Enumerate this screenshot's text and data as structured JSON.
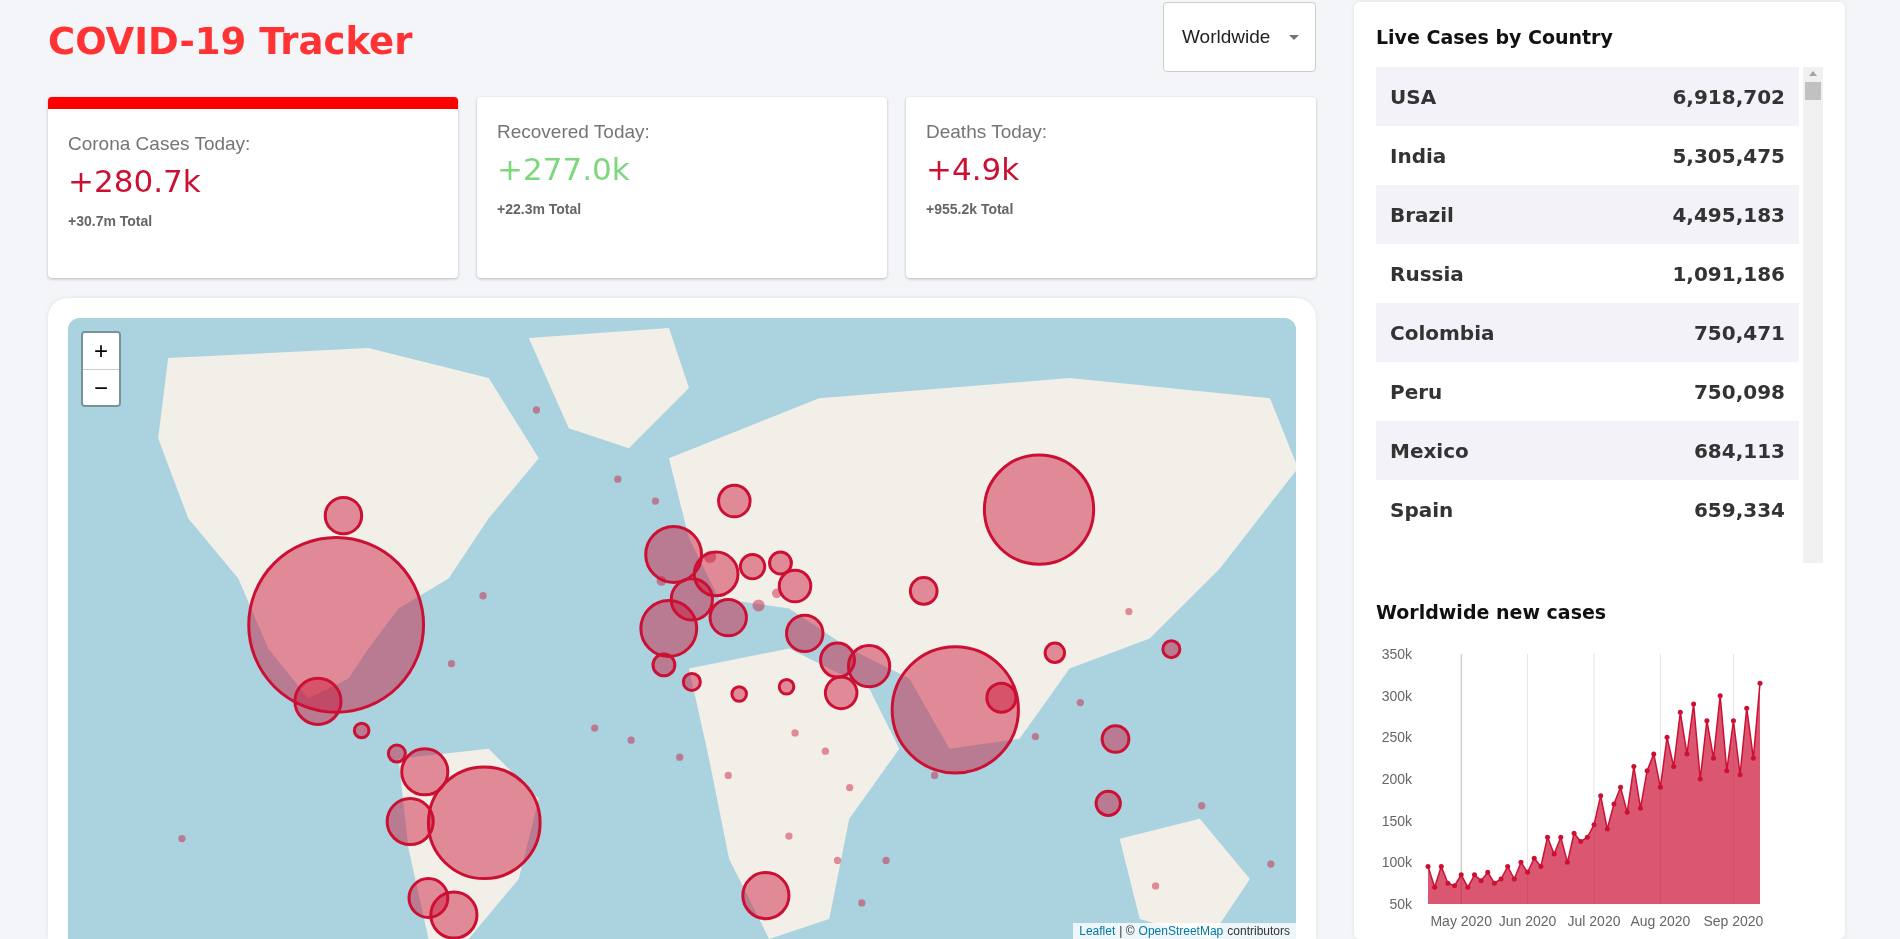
{
  "header": {
    "title": "COVID-19 Tracker",
    "country_select": {
      "value": "Worldwide"
    }
  },
  "info_cards": [
    {
      "title": "Corona Cases Today:",
      "value": "+280.7k",
      "total": "+30.7m Total",
      "color": "#cc1034",
      "selected": true
    },
    {
      "title": "Recovered Today:",
      "value": "+277.0k",
      "total": "+22.3m Total",
      "color": "#7dd87d",
      "selected": false
    },
    {
      "title": "Deaths Today:",
      "value": "+4.9k",
      "total": "+955.2k Total",
      "color": "#cc1034",
      "selected": false
    }
  ],
  "map": {
    "zoom_in": "+",
    "zoom_out": "−",
    "attribution": {
      "leaflet_link": "Leaflet",
      "separator": "| ©",
      "osm_link": "OpenStreetMap",
      "suffix": "contributors"
    }
  },
  "live_cases": {
    "title": "Live Cases by Country",
    "rows": [
      {
        "country": "USA",
        "cases": "6,918,702"
      },
      {
        "country": "India",
        "cases": "5,305,475"
      },
      {
        "country": "Brazil",
        "cases": "4,495,183"
      },
      {
        "country": "Russia",
        "cases": "1,091,186"
      },
      {
        "country": "Colombia",
        "cases": "750,471"
      },
      {
        "country": "Peru",
        "cases": "750,098"
      },
      {
        "country": "Mexico",
        "cases": "684,113"
      },
      {
        "country": "Spain",
        "cases": "659,334"
      }
    ]
  },
  "new_cases": {
    "title": "Worldwide new cases",
    "chart_data": {
      "type": "area",
      "categories": [
        null,
        null,
        null,
        null,
        null,
        "May 2020",
        null,
        null,
        null,
        null,
        null,
        null,
        null,
        null,
        null,
        "Jun 2020",
        null,
        null,
        null,
        null,
        null,
        null,
        null,
        null,
        null,
        "Jul 2020",
        null,
        null,
        null,
        null,
        null,
        null,
        null,
        null,
        null,
        "Aug 2020",
        null,
        null,
        null,
        null,
        null,
        null,
        null,
        null,
        null,
        null,
        "Sep 2020",
        null,
        null,
        null,
        null
      ],
      "series": [
        {
          "color": "#cc1034",
          "values": [
            95000,
            70000,
            95000,
            75000,
            72000,
            85000,
            70000,
            85000,
            78000,
            88000,
            75000,
            80000,
            95000,
            80000,
            100000,
            88000,
            105000,
            95000,
            130000,
            110000,
            130000,
            100000,
            135000,
            125000,
            130000,
            145000,
            180000,
            140000,
            170000,
            190000,
            160000,
            215000,
            165000,
            210000,
            230000,
            190000,
            250000,
            215000,
            280000,
            230000,
            290000,
            200000,
            270000,
            225000,
            300000,
            210000,
            270000,
            205000,
            285000,
            225000,
            315000
          ]
        }
      ],
      "ylim": [
        50000,
        350000
      ],
      "grid": "x",
      "yticks": [
        {
          "value": 50000,
          "label": "50k"
        },
        {
          "value": 100000,
          "label": "100k"
        },
        {
          "value": 150000,
          "label": "150k"
        },
        {
          "value": 200000,
          "label": "200k"
        },
        {
          "value": 250000,
          "label": "250k"
        },
        {
          "value": 300000,
          "label": "300k"
        },
        {
          "value": 350000,
          "label": "350k"
        }
      ]
    }
  }
}
